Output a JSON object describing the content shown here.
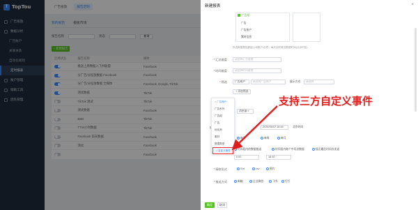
{
  "app": {
    "logo_text": "TopTou",
    "logo_mark": "T"
  },
  "sidebar": {
    "items": [
      {
        "label": "广告投放"
      },
      {
        "label": "数据分析"
      },
      {
        "label": "广告账户"
      },
      {
        "label": "关联关系"
      },
      {
        "label": "自动化规则"
      },
      {
        "label": "定时报表"
      },
      {
        "label": "账户管理"
      },
      {
        "label": "辅助工具"
      },
      {
        "label": "团队管理"
      }
    ]
  },
  "topbar": {
    "tabs": [
      "广告投放",
      "报告定制"
    ]
  },
  "content": {
    "subtabs": [
      "我的报告",
      "模板市场"
    ],
    "filter_labels": [
      "报告名称",
      "状态"
    ],
    "filter_button": "查询",
    "add_button": "+ 新建报告",
    "table_headers": [
      "启用状态",
      "报告名称",
      "媒体",
      "最近发送时间"
    ],
    "rows": [
      {
        "name": "推送上周数据入飞书联盟",
        "media": "Facebook",
        "time": "",
        "on": true
      },
      {
        "name": "分广告/分投放数据 Facebook",
        "media": "Facebook",
        "time": "",
        "on": true
      },
      {
        "name": "分广告/分投放数据 全媒体",
        "media": "Facebook, Google, TikTok",
        "time": "",
        "on": true
      },
      {
        "name": "测试数据",
        "media": "TikTok",
        "time": "",
        "on": true
      },
      {
        "name": "TikTok 测试",
        "media": "TikTok",
        "time": "2023-06-01",
        "on": false
      },
      {
        "name": "测试数据",
        "media": "Facebook",
        "time": "",
        "on": false
      },
      {
        "name": "BBB",
        "media": "TikTok",
        "time": "",
        "on": false
      },
      {
        "name": "TT24小时数据",
        "media": "TikTok",
        "time": "",
        "on": false
      },
      {
        "name": "Facebook 前天数据",
        "media": "Facebook",
        "time": "",
        "on": false
      },
      {
        "name": "测试",
        "media": "Facebook",
        "time": "2023-03-1",
        "on": false
      },
      {
        "name": "",
        "media": "Facebook",
        "time": "2023-03-1",
        "on": false
      }
    ]
  },
  "drawer": {
    "title": "新建报表",
    "close_icon": "×",
    "media_options": [
      "广告组",
      "广告",
      "广告账户",
      "素材信息"
    ],
    "hint": "所选数据是指直接公司账户/合同，每天定时推送数据时间(北京时区)",
    "fields": {
      "summary_label": "汇总维度",
      "summary_placeholder": "请选择汇总维度",
      "time_label": "时间维度",
      "time_placeholder": "请选择时间维度",
      "filter_label": "筛选",
      "filter_select": "广告账户",
      "filter_input_placeholder": "请选择广告账户",
      "filter_extra_label": "展示方式",
      "filter_extra_value": "请选择",
      "add_filter": "+ 添加筛选",
      "metric_label": "指标",
      "metric_tag_label": "x",
      "metric_tag_value": "消息量",
      "timezone_label": "时区设置",
      "exec_label": "执行任务时间",
      "exec_date": "2024/06/07 18:48",
      "exec_tz": "北京时间",
      "freq_label": "发送频率",
      "freq_options": [
        "每天",
        "每周",
        "每月"
      ],
      "range_label": "数据时间",
      "range_options": [
        "时间段内的数据推送",
        "时间段内每个中间点数据",
        "接近最后时间点发送"
      ],
      "time_from": "0:00",
      "time_to": "18:30",
      "push_label": "接收形式",
      "push_options": [
        "Sht",
        "csv",
        "图片"
      ],
      "channel_label": "推送方式",
      "channel_options": [
        "邮箱",
        "企业微信",
        "飞书",
        "钉钉"
      ]
    },
    "dropdown": {
      "items": [
        "广告账户",
        "广告系列",
        "广告组",
        "广告",
        "优化师",
        "素材",
        "数据类型",
        "自定义事件"
      ],
      "highlighted": "自定义事件"
    },
    "ok_button": "确定",
    "cancel_button": "取消"
  },
  "annotation": {
    "text": "支持三方自定义事件",
    "color": "#e11d1d"
  }
}
